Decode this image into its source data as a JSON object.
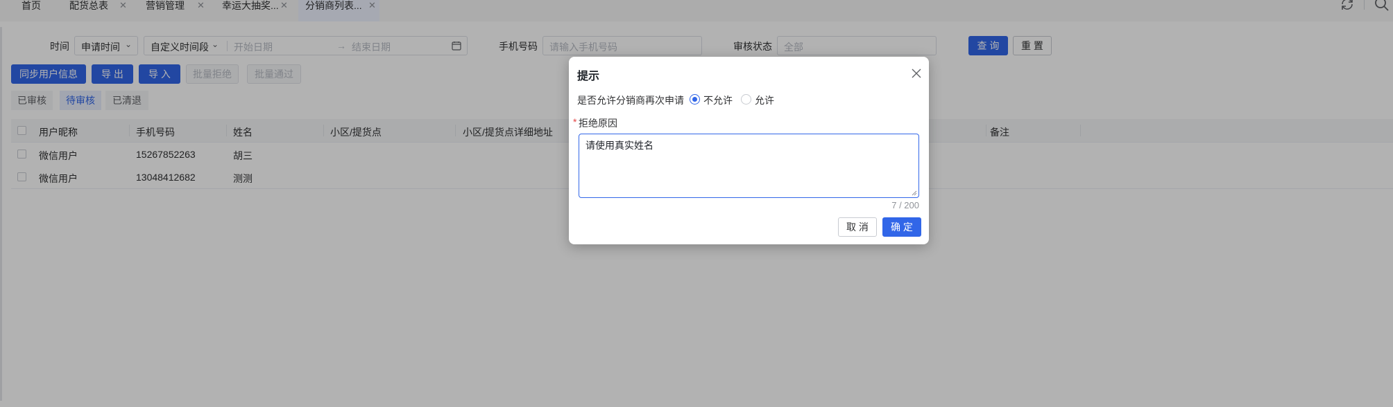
{
  "tabs": [
    {
      "label": "首页",
      "closable": false
    },
    {
      "label": "配货总表",
      "closable": true
    },
    {
      "label": "营销管理",
      "closable": true
    },
    {
      "label": "幸运大抽奖...",
      "closable": true
    },
    {
      "label": "分销商列表...",
      "closable": true,
      "active": true
    }
  ],
  "toolbar_icons": [
    "refresh-icon",
    "search-icon"
  ],
  "filters": {
    "time_label": "时间",
    "time_type": "申请时间",
    "time_range": "自定义时间段",
    "start_placeholder": "开始日期",
    "range_arrow": "→",
    "end_placeholder": "结束日期",
    "phone_label": "手机号码",
    "phone_placeholder": "请输入手机号码",
    "status_label": "审核状态",
    "status_value": "全部",
    "query_btn": "查 询",
    "reset_btn": "重 置"
  },
  "actions": {
    "sync": "同步用户信息",
    "export": "导 出",
    "import": "导 入",
    "batch_reject": "批量拒绝",
    "batch_pass": "批量通过"
  },
  "status_tabs": [
    {
      "label": "已审核",
      "active": false
    },
    {
      "label": "待审核",
      "active": true
    },
    {
      "label": "已清退",
      "active": false
    }
  ],
  "table": {
    "columns": [
      "用户昵称",
      "手机号码",
      "姓名",
      "小区/提货点",
      "小区/提货点详细地址",
      "备注"
    ],
    "rows": [
      {
        "nickname": "微信用户",
        "phone": "15267852263",
        "name": "胡三"
      },
      {
        "nickname": "微信用户",
        "phone": "13048412682",
        "name": "测测"
      }
    ]
  },
  "dialog": {
    "title": "提示",
    "question": "是否允许分销商再次申请",
    "options": [
      {
        "label": "不允许",
        "selected": true
      },
      {
        "label": "允许",
        "selected": false
      }
    ],
    "required_mark": "*",
    "reason_label": "拒绝原因",
    "reason_value": "请使用真实姓名",
    "counter": "7 / 200",
    "cancel": "取 消",
    "confirm": "确 定"
  },
  "colors": {
    "primary": "#3166e8",
    "mask": "rgba(0,0,0,0.30)"
  }
}
